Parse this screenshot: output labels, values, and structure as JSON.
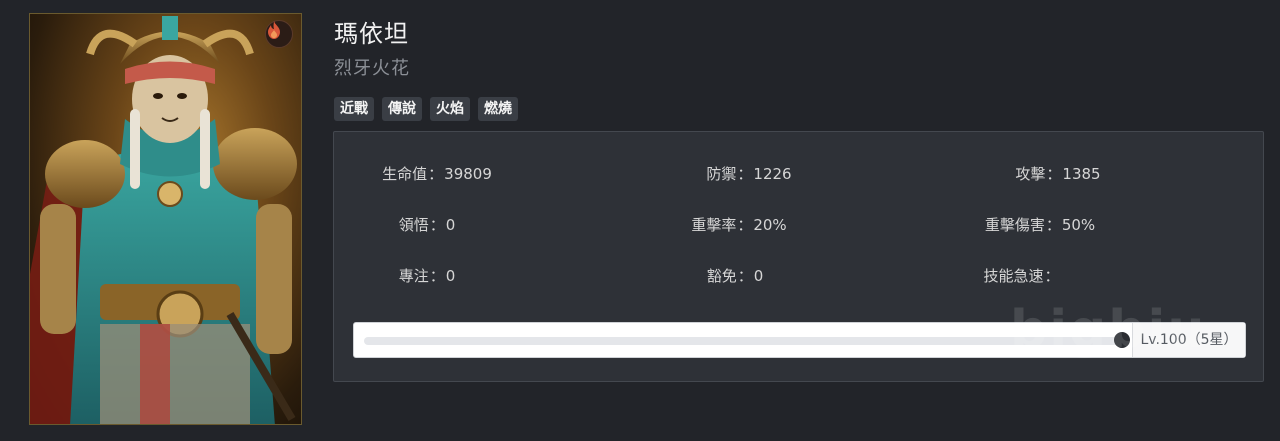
{
  "hero": {
    "name": "瑪依坦",
    "subtitle": "烈牙火花",
    "element_icon": "fire-icon",
    "tags": [
      "近戰",
      "傳說",
      "火焰",
      "燃燒"
    ]
  },
  "stats": {
    "hp": {
      "label": "生命值",
      "value": "39809"
    },
    "defense": {
      "label": "防禦",
      "value": "1226"
    },
    "attack": {
      "label": "攻擊",
      "value": "1385"
    },
    "insight": {
      "label": "領悟",
      "value": "0"
    },
    "crit_rate": {
      "label": "重擊率",
      "value": "20%"
    },
    "crit_damage": {
      "label": "重擊傷害",
      "value": "50%"
    },
    "focus": {
      "label": "專注",
      "value": "0"
    },
    "immunity": {
      "label": "豁免",
      "value": "0"
    },
    "skill_haste": {
      "label": "技能急速",
      "value": ""
    },
    "separator": "："
  },
  "level_slider": {
    "label": "Lv.100（5星）",
    "fraction": 1.0
  },
  "watermark": "bigbiu",
  "colors": {
    "background": "#222429",
    "panel": "#2e3137",
    "tag": "#3a3e45",
    "fire": "#d9573a"
  }
}
